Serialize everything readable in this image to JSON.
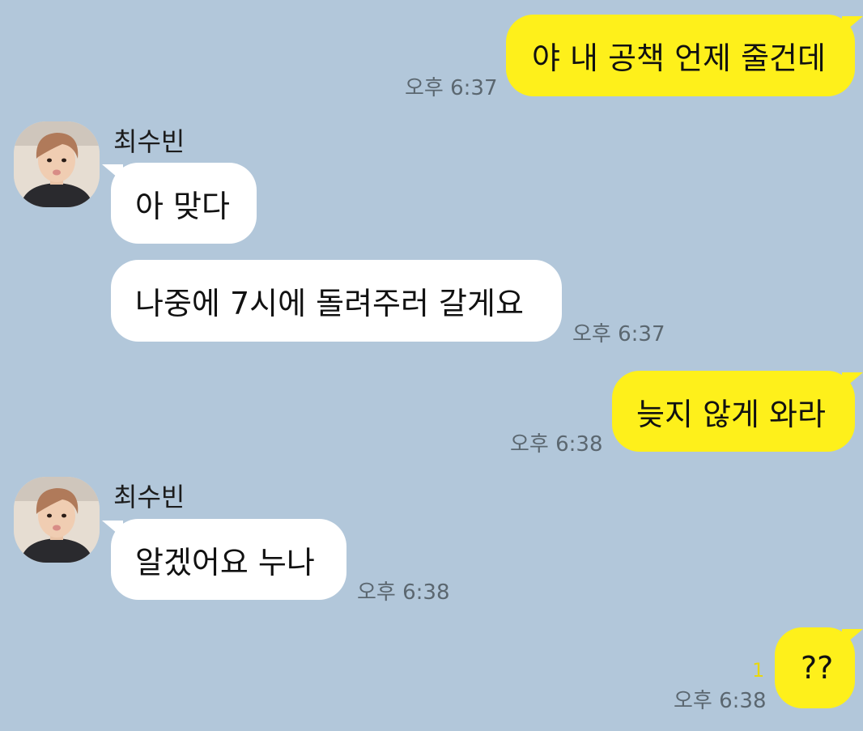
{
  "contact": {
    "name": "최수빈"
  },
  "messages": [
    {
      "sender": "me",
      "text": "야 내 공책 언제 줄건데",
      "time": "오후 6:37"
    },
    {
      "sender": "them",
      "text": "아 맞다"
    },
    {
      "sender": "them",
      "text": "나중에 7시에 돌려주러 갈게요",
      "time": "오후 6:37"
    },
    {
      "sender": "me",
      "text": "늦지 않게 와라",
      "time": "오후 6:38"
    },
    {
      "sender": "them",
      "text": "알겠어요 누나",
      "time": "오후 6:38"
    },
    {
      "sender": "me",
      "text": "??",
      "time": "오후 6:38",
      "unread": "1"
    }
  ],
  "colors": {
    "background": "#b2c7da",
    "my_bubble": "#fef01b",
    "their_bubble": "#ffffff",
    "unread": "#e8d70e"
  }
}
